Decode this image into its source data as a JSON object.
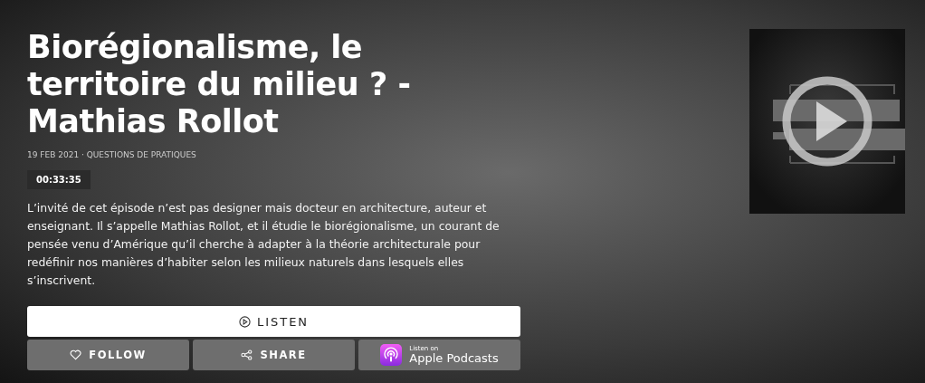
{
  "episode": {
    "title": "Biorégionalisme, le territoire du milieu ? - Mathias Rollot",
    "meta": "19 FEB 2021 · QUESTIONS DE PRATIQUES",
    "duration": "00:33:35",
    "description": "L’invité de cet épisode n’est pas designer mais docteur en architecture, auteur et enseignant. Il s’appelle Mathias Rollot, et il étudie le biorégionalisme, un courant de pensée venu d’Amérique qu’il cherche à adapter à la théorie architecturale pour redéfinir nos manières d’habiter selon les milieux naturels dans lesquels elles s’inscrivent."
  },
  "listen_button": {
    "label": "LISTEN"
  },
  "actions": [
    {
      "kind": "follow",
      "label": "FOLLOW"
    },
    {
      "kind": "share",
      "label": "SHARE"
    },
    {
      "kind": "apple",
      "small": "Listen on",
      "label": "Apple Podcasts"
    }
  ]
}
